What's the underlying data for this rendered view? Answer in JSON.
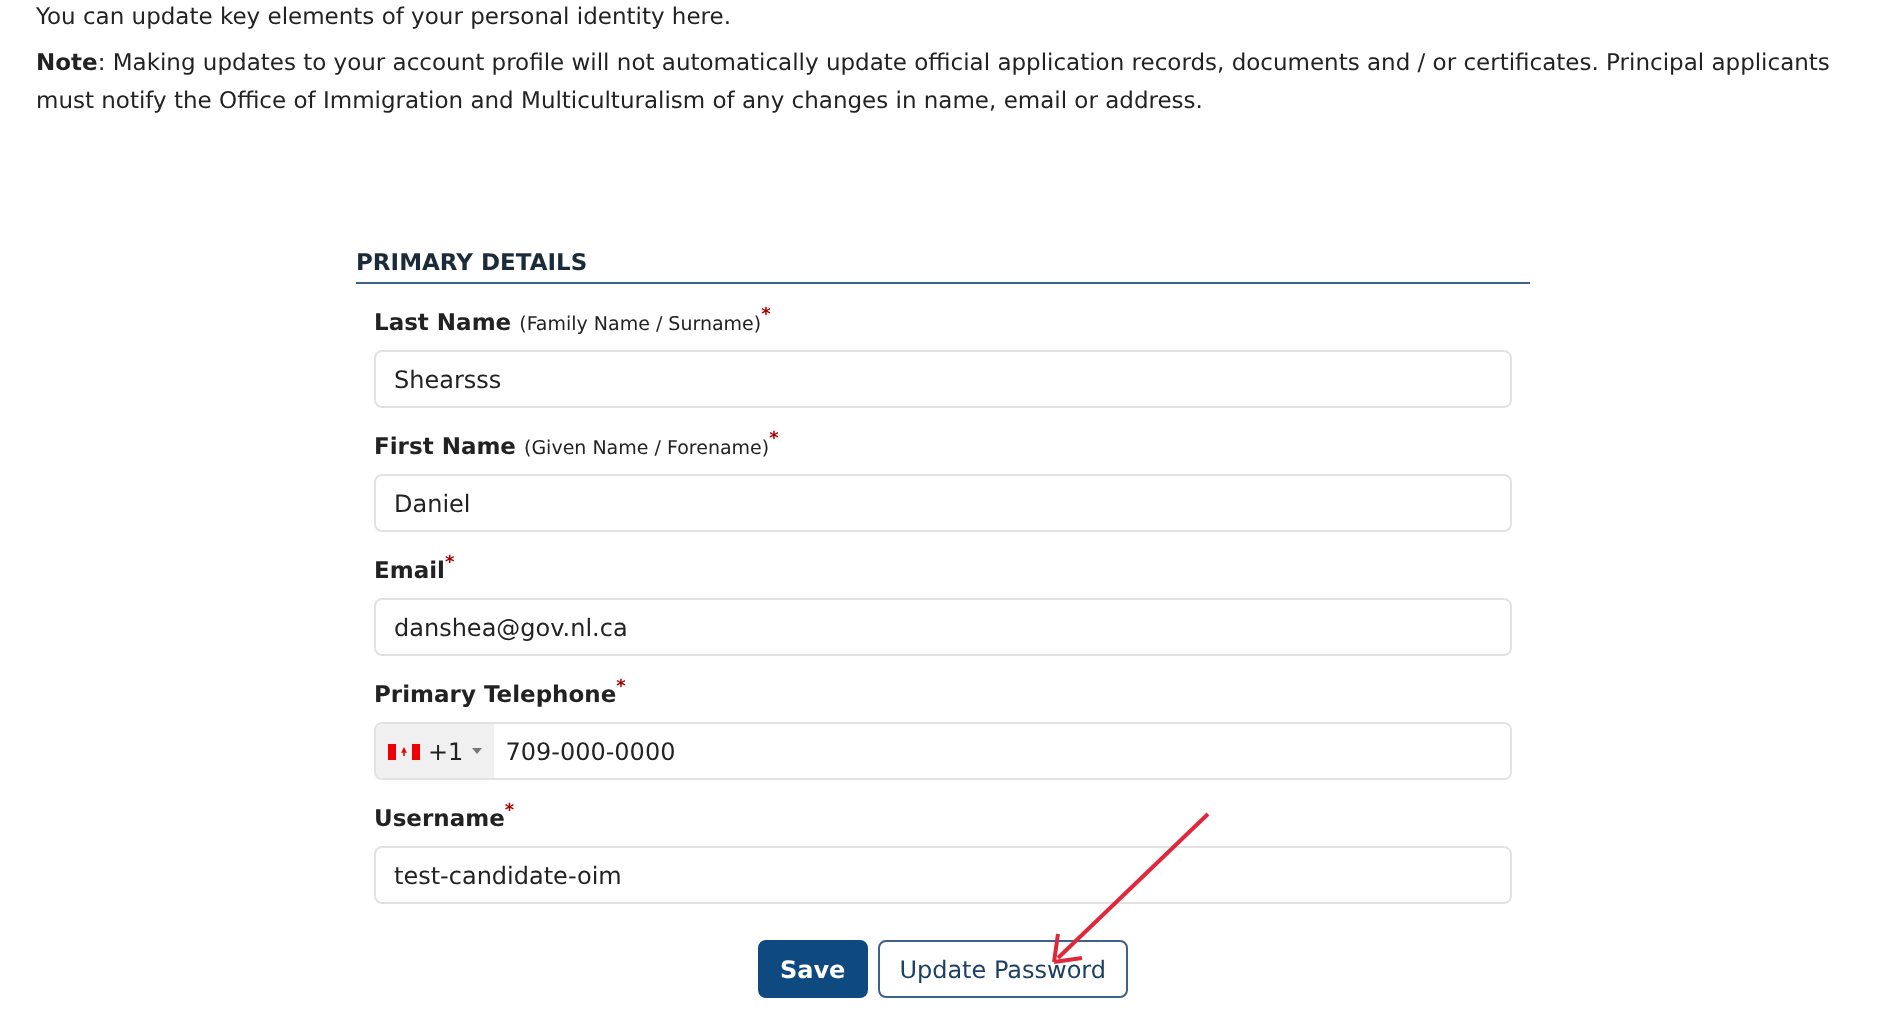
{
  "intro": "You can update key elements of your personal identity here.",
  "note": "**Note**: Making updates to your account profile will not automatically update official application records, documents and / or certificates. Principal applicants must notify the Office of Immigration and Multiculturalism of any changes in name, email or address.",
  "section_title": "PRIMARY DETAILS",
  "fields": [
    {
      "kind": "text",
      "label": "Last Name",
      "hint": "(Family Name / Surname)",
      "required_mark": "*",
      "value": "Shearsss"
    },
    {
      "kind": "text",
      "label": "First Name",
      "hint": "(Given Name / Forename)",
      "required_mark": "*",
      "value": "Daniel"
    },
    {
      "kind": "text",
      "label": "Email",
      "required_mark": "*",
      "value": "danshea@gov.nl.ca"
    },
    {
      "kind": "phone",
      "label": "Primary Telephone",
      "required_mark": "*",
      "dial_code": "+1",
      "value": "709-000-0000"
    },
    {
      "kind": "text",
      "label": "Username",
      "required_mark": "*",
      "value": "test-candidate-oim"
    }
  ],
  "buttons": [
    {
      "kind": "primary",
      "label": "Save"
    },
    {
      "kind": "outline",
      "label": "Update Password"
    }
  ]
}
